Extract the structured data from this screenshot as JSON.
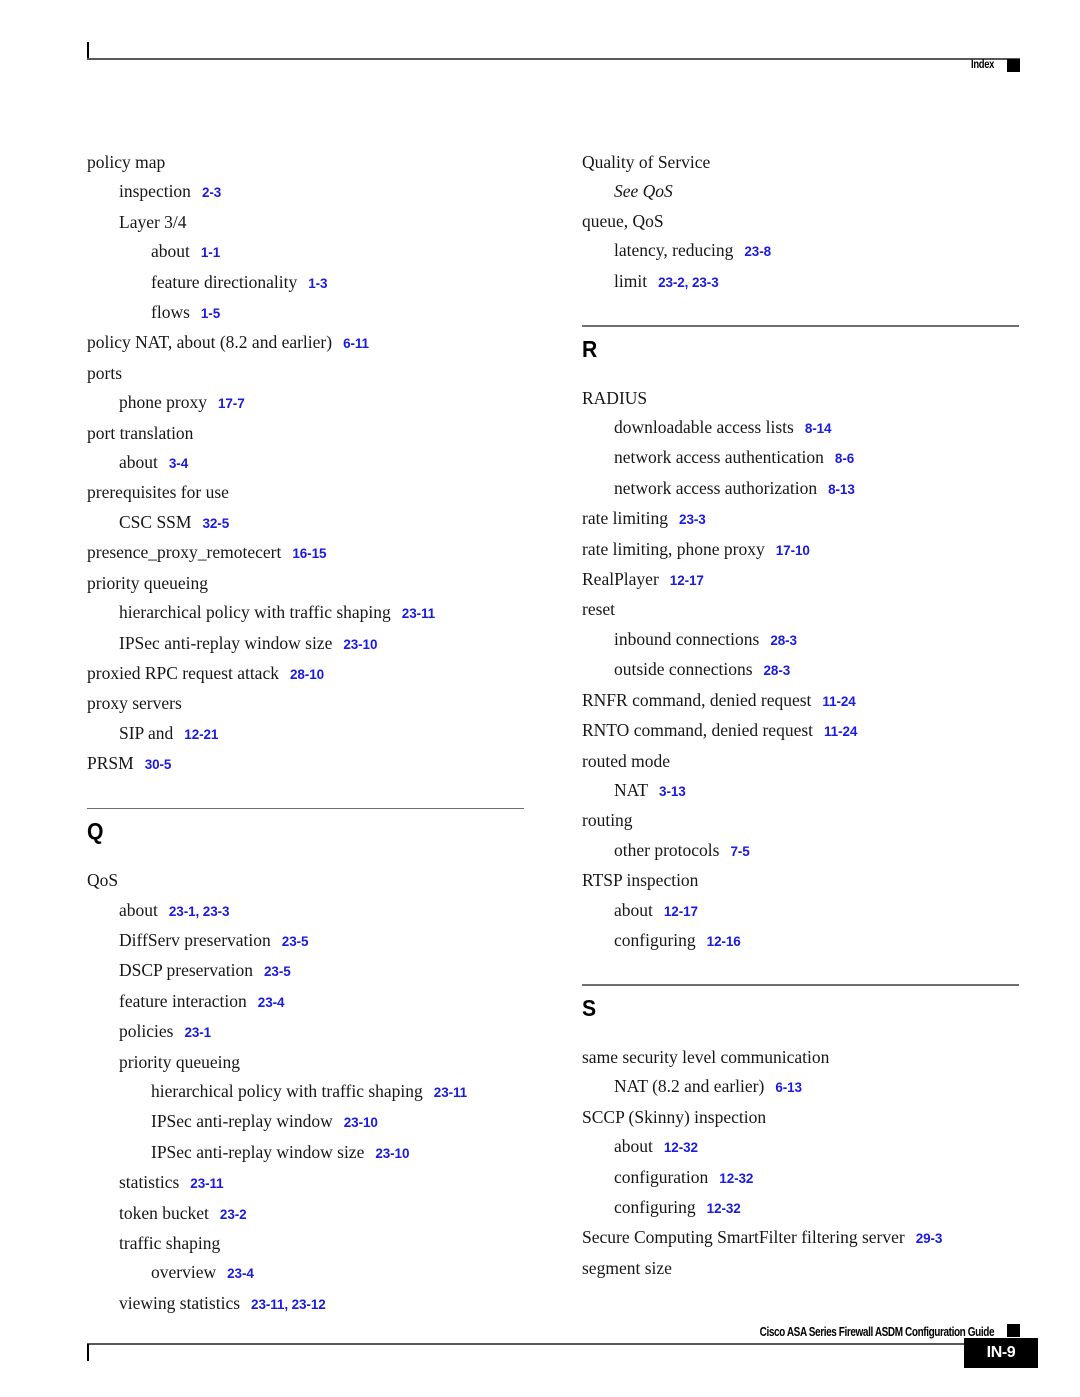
{
  "header": {
    "label": "Index"
  },
  "footer": {
    "guide_title": "Cisco ASA Series Firewall ASDM Configuration Guide",
    "page_number": "IN-9"
  },
  "columns": [
    {
      "name": "left-column",
      "blocks": [
        {
          "type": "entries",
          "entries": [
            {
              "level": 0,
              "term": "policy map",
              "pages": ""
            },
            {
              "level": 1,
              "term": "inspection",
              "pages": "2-3"
            },
            {
              "level": 1,
              "term": "Layer 3/4",
              "pages": ""
            },
            {
              "level": 2,
              "term": "about",
              "pages": "1-1"
            },
            {
              "level": 2,
              "term": "feature directionality",
              "pages": "1-3"
            },
            {
              "level": 2,
              "term": "flows",
              "pages": "1-5"
            },
            {
              "level": 0,
              "term": "policy NAT, about (8.2 and earlier)",
              "pages": "6-11"
            },
            {
              "level": 0,
              "term": "ports",
              "pages": ""
            },
            {
              "level": 1,
              "term": "phone proxy",
              "pages": "17-7"
            },
            {
              "level": 0,
              "term": "port translation",
              "pages": ""
            },
            {
              "level": 1,
              "term": "about",
              "pages": "3-4"
            },
            {
              "level": 0,
              "term": "prerequisites for use",
              "pages": ""
            },
            {
              "level": 1,
              "term": "CSC SSM",
              "pages": "32-5"
            },
            {
              "level": 0,
              "term": "presence_proxy_remotecert",
              "pages": "16-15"
            },
            {
              "level": 0,
              "term": "priority queueing",
              "pages": ""
            },
            {
              "level": 1,
              "term": "hierarchical policy with traffic shaping",
              "pages": "23-11"
            },
            {
              "level": 1,
              "term": "IPSec anti-replay window size",
              "pages": "23-10"
            },
            {
              "level": 0,
              "term": "proxied RPC request attack",
              "pages": "28-10"
            },
            {
              "level": 0,
              "term": "proxy servers",
              "pages": ""
            },
            {
              "level": 1,
              "term": "SIP and",
              "pages": "12-21"
            },
            {
              "level": 0,
              "term": "PRSM",
              "pages": "30-5"
            }
          ]
        },
        {
          "type": "section",
          "letter": "Q"
        },
        {
          "type": "entries",
          "entries": [
            {
              "level": 0,
              "term": "QoS",
              "pages": ""
            },
            {
              "level": 1,
              "term": "about",
              "pages": "23-1, 23-3"
            },
            {
              "level": 1,
              "term": "DiffServ preservation",
              "pages": "23-5"
            },
            {
              "level": 1,
              "term": "DSCP preservation",
              "pages": "23-5"
            },
            {
              "level": 1,
              "term": "feature interaction",
              "pages": "23-4"
            },
            {
              "level": 1,
              "term": "policies",
              "pages": "23-1"
            },
            {
              "level": 1,
              "term": "priority queueing",
              "pages": ""
            },
            {
              "level": 2,
              "term": "hierarchical policy with traffic shaping",
              "pages": "23-11"
            },
            {
              "level": 2,
              "term": "IPSec anti-replay window",
              "pages": "23-10"
            },
            {
              "level": 2,
              "term": "IPSec anti-replay window size",
              "pages": "23-10"
            },
            {
              "level": 1,
              "term": "statistics",
              "pages": "23-11"
            },
            {
              "level": 1,
              "term": "token bucket",
              "pages": "23-2"
            },
            {
              "level": 1,
              "term": "traffic shaping",
              "pages": ""
            },
            {
              "level": 2,
              "term": "overview",
              "pages": "23-4"
            },
            {
              "level": 1,
              "term": "viewing statistics",
              "pages": "23-11, 23-12"
            }
          ]
        }
      ]
    },
    {
      "name": "right-column",
      "blocks": [
        {
          "type": "entries",
          "entries": [
            {
              "level": 0,
              "term": "Quality of Service",
              "pages": ""
            },
            {
              "level": 1,
              "term": "See QoS",
              "pages": "",
              "see": true,
              "see_prefix": "See",
              "see_target": "QoS"
            },
            {
              "level": 0,
              "term": "queue, QoS",
              "pages": ""
            },
            {
              "level": 1,
              "term": "latency, reducing",
              "pages": "23-8"
            },
            {
              "level": 1,
              "term": "limit",
              "pages": "23-2, 23-3"
            }
          ]
        },
        {
          "type": "section",
          "letter": "R"
        },
        {
          "type": "entries",
          "entries": [
            {
              "level": 0,
              "term": "RADIUS",
              "pages": ""
            },
            {
              "level": 1,
              "term": "downloadable access lists",
              "pages": "8-14"
            },
            {
              "level": 1,
              "term": "network access authentication",
              "pages": "8-6"
            },
            {
              "level": 1,
              "term": "network access authorization",
              "pages": "8-13"
            },
            {
              "level": 0,
              "term": "rate limiting",
              "pages": "23-3"
            },
            {
              "level": 0,
              "term": "rate limiting, phone proxy",
              "pages": "17-10"
            },
            {
              "level": 0,
              "term": "RealPlayer",
              "pages": "12-17"
            },
            {
              "level": 0,
              "term": "reset",
              "pages": ""
            },
            {
              "level": 1,
              "term": "inbound connections",
              "pages": "28-3"
            },
            {
              "level": 1,
              "term": "outside connections",
              "pages": "28-3"
            },
            {
              "level": 0,
              "term": "RNFR command, denied request",
              "pages": "11-24"
            },
            {
              "level": 0,
              "term": "RNTO command, denied request",
              "pages": "11-24"
            },
            {
              "level": 0,
              "term": "routed mode",
              "pages": ""
            },
            {
              "level": 1,
              "term": "NAT",
              "pages": "3-13"
            },
            {
              "level": 0,
              "term": "routing",
              "pages": ""
            },
            {
              "level": 1,
              "term": "other protocols",
              "pages": "7-5"
            },
            {
              "level": 0,
              "term": "RTSP inspection",
              "pages": ""
            },
            {
              "level": 1,
              "term": "about",
              "pages": "12-17"
            },
            {
              "level": 1,
              "term": "configuring",
              "pages": "12-16"
            }
          ]
        },
        {
          "type": "section",
          "letter": "S"
        },
        {
          "type": "entries",
          "entries": [
            {
              "level": 0,
              "term": "same security level communication",
              "pages": ""
            },
            {
              "level": 1,
              "term": "NAT (8.2 and earlier)",
              "pages": "6-13"
            },
            {
              "level": 0,
              "term": "SCCP (Skinny) inspection",
              "pages": ""
            },
            {
              "level": 1,
              "term": "about",
              "pages": "12-32"
            },
            {
              "level": 1,
              "term": "configuration",
              "pages": "12-32"
            },
            {
              "level": 1,
              "term": "configuring",
              "pages": "12-32"
            },
            {
              "level": 0,
              "term": "Secure Computing SmartFilter filtering server",
              "pages": "29-3"
            },
            {
              "level": 0,
              "term": "segment size",
              "pages": ""
            }
          ]
        }
      ]
    }
  ]
}
